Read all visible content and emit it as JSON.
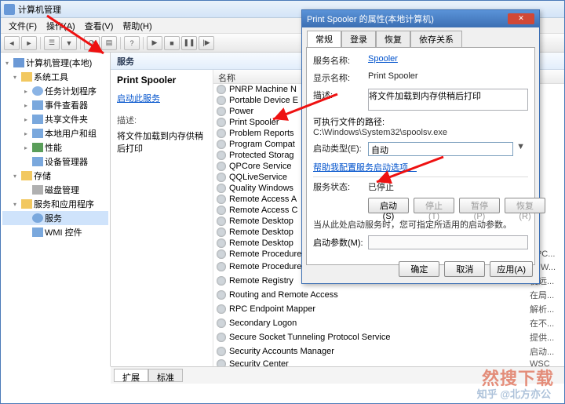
{
  "main": {
    "title": "计算机管理",
    "menu": {
      "file": "文件(F)",
      "action": "操作(A)",
      "view": "查看(V)",
      "help": "帮助(H)"
    },
    "tree": {
      "root": "计算机管理(本地)",
      "systools": "系统工具",
      "task": "任务计划程序",
      "event": "事件查看器",
      "share": "共享文件夹",
      "users": "本地用户和组",
      "perf": "性能",
      "device": "设备管理器",
      "storage": "存储",
      "disk": "磁盘管理",
      "svcapp": "服务和应用程序",
      "svc": "服务",
      "wmi": "WMI 控件"
    }
  },
  "mid": {
    "header": "服务",
    "col_name": "名称",
    "detail_title": "Print Spooler",
    "start_link": "启动此服务",
    "desc_label": "描述:",
    "desc_text": "将文件加载到内存供稍后打印"
  },
  "svcs": [
    "PNRP Machine N",
    "Portable Device E",
    "Power",
    "Print Spooler",
    "Problem Reports",
    "Program Compat",
    "Protected Storag",
    "QPCore Service",
    "QQLiveService",
    "Quality Windows",
    "Remote Access A",
    "Remote Access C",
    "Remote Desktop",
    "Remote Desktop",
    "Remote Desktop",
    "Remote Procedure Call (RPC)",
    "Remote Procedure Call (RPC) Locator",
    "Remote Registry",
    "Routing and Remote Access",
    "RPC Endpoint Mapper",
    "Secondary Logon",
    "Secure Socket Tunneling Protocol Service",
    "Security Accounts Manager",
    "Security Center"
  ],
  "svc_status": [
    "",
    "",
    "",
    "",
    "",
    "",
    "",
    "",
    "",
    "",
    "",
    "",
    "",
    "",
    "",
    "RPC...",
    "在 W...",
    "使远...",
    "在局...",
    "解析...",
    "在不...",
    "提供...",
    "启动...",
    "WSC"
  ],
  "tabs": {
    "ext": "扩展",
    "std": "标准"
  },
  "dlg": {
    "title": "Print Spooler 的属性(本地计算机)",
    "tabs": {
      "general": "常规",
      "logon": "登录",
      "recovery": "恢复",
      "deps": "依存关系"
    },
    "svc_name_label": "服务名称:",
    "svc_name": "Spooler",
    "disp_name_label": "显示名称:",
    "disp_name": "Print Spooler",
    "desc_label": "描述:",
    "desc": "将文件加载到内存供稍后打印",
    "exe_label": "可执行文件的路径:",
    "exe_path": "C:\\Windows\\System32\\spoolsv.exe",
    "start_type_label": "启动类型(E):",
    "start_type": "自动",
    "help_link": "帮助我配置服务启动选项。",
    "status_label": "服务状态:",
    "status": "已停止",
    "btn_start": "启动(S)",
    "btn_stop": "停止(T)",
    "btn_pause": "暂停(P)",
    "btn_resume": "恢复(R)",
    "hint": "当从此处启动服务时，您可指定所适用的启动参数。",
    "param_label": "启动参数(M):",
    "ok": "确定",
    "cancel": "取消",
    "apply": "应用(A)"
  },
  "watermark": "然搜下载",
  "wm_zhihu": "知乎 @北方亦公"
}
